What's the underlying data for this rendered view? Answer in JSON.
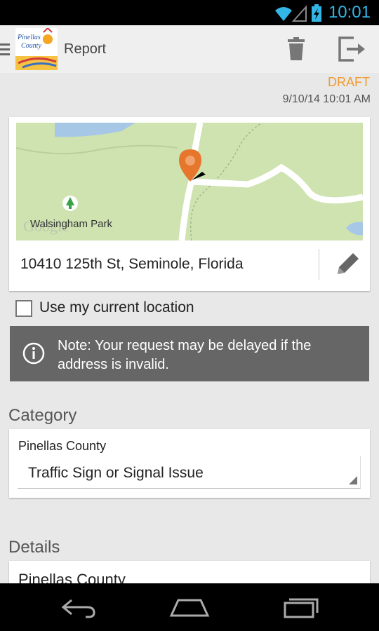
{
  "status_bar": {
    "time": "10:01",
    "wifi_icon": "wifi-icon",
    "signal_icon": "signal-icon",
    "battery_icon": "battery-charging-icon"
  },
  "action_bar": {
    "title": "Report",
    "logo_text_line1": "Pinellas",
    "logo_text_line2": "County",
    "menu_icon": "menu-icon",
    "delete_icon": "trash-icon",
    "exit_icon": "exit-icon"
  },
  "report": {
    "status": "DRAFT",
    "timestamp": "9/10/14 10:01 AM"
  },
  "location": {
    "map_label": "Walsingham Park",
    "map_watermark": "Google",
    "address": "10410 125th St, Seminole, Florida",
    "edit_icon": "pencil-icon",
    "use_current_label": "Use my current location",
    "use_current_checked": false
  },
  "note": {
    "icon": "info-icon",
    "text": "Note: Your request may be delayed if the address is invalid."
  },
  "category": {
    "title": "Category",
    "agency": "Pinellas County",
    "selected": "Traffic Sign or Signal Issue"
  },
  "details": {
    "title": "Details",
    "agency": "Pinellas County"
  },
  "nav_bar": {
    "back_icon": "back-icon",
    "home_icon": "home-icon",
    "recents_icon": "recents-icon"
  },
  "colors": {
    "accent": "#f39a2e",
    "note_bg": "#666666",
    "status_blue": "#33b5e5"
  }
}
